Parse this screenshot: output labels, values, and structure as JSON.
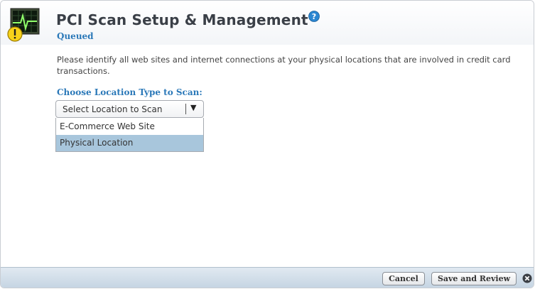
{
  "header": {
    "title": "PCI Scan Setup & Management",
    "status": "Queued",
    "app_icon": "monitor-warning-icon",
    "help_icon": "help-icon"
  },
  "main": {
    "description": "Please identify all web sites and internet connections at your physical locations that are involved in credit card transactions.",
    "choose_label": "Choose Location Type to Scan:",
    "select": {
      "value": "Select Location to Scan",
      "options": [
        "E-Commerce Web Site",
        "Physical Location"
      ],
      "highlighted_option": "Physical Location"
    }
  },
  "footer": {
    "cancel_label": "Cancel",
    "save_label": "Save and Review",
    "close_icon": "close-icon"
  },
  "colors": {
    "accent_text": "#2a78b8",
    "highlight": "#a8c6dc",
    "footer_bar": "#c6d5e3"
  }
}
